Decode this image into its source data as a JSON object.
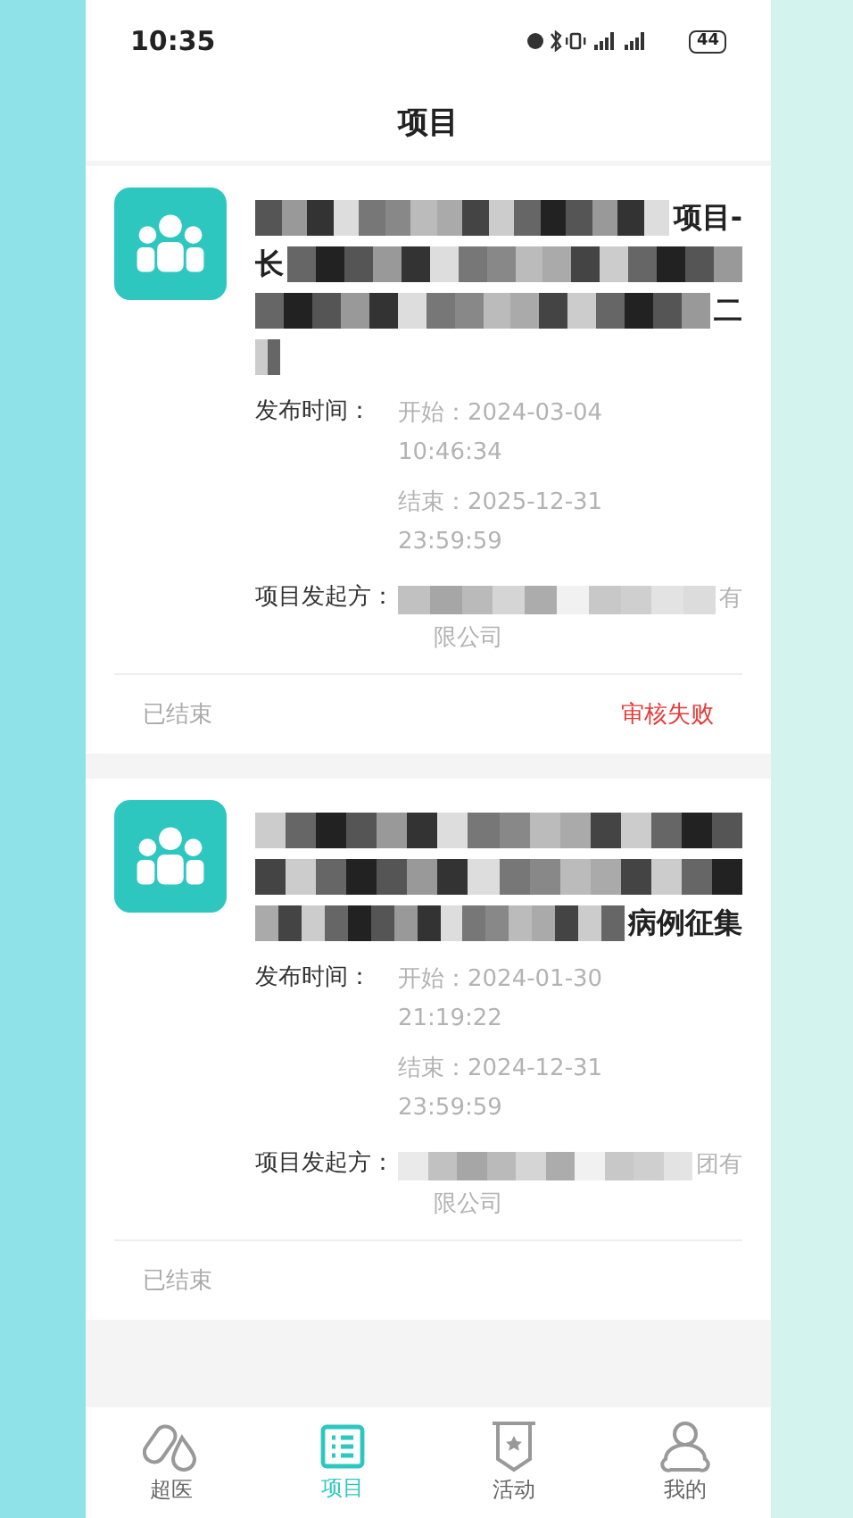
{
  "status_bar": {
    "time": "10:35",
    "battery": "44"
  },
  "header": {
    "title": "项目"
  },
  "projects": [
    {
      "title_lines": [
        [
          {
            "kind": "mosaic"
          },
          {
            "kind": "text",
            "text": "项目-"
          }
        ],
        [
          {
            "kind": "text",
            "text": "长"
          },
          {
            "kind": "mosaic"
          }
        ],
        [
          {
            "kind": "mosaic"
          },
          {
            "kind": "text",
            "text": "二"
          }
        ],
        [
          {
            "kind": "short_mosaic"
          }
        ]
      ],
      "time_label": "发布时间：",
      "start": "开始：2024-03-04",
      "start_time": "10:46:34",
      "end": "结束：2025-12-31",
      "end_time": "23:59:59",
      "organizer_label": "项目发起方：",
      "organizer_lines": [
        [
          {
            "kind": "mosaic"
          },
          {
            "kind": "text",
            "text": "有"
          }
        ],
        [
          {
            "kind": "text",
            "text": "限公司"
          }
        ]
      ],
      "status": "已结束",
      "review": "审核失败"
    },
    {
      "title_lines": [
        [
          {
            "kind": "mosaic"
          }
        ],
        [
          {
            "kind": "mosaic"
          }
        ],
        [
          {
            "kind": "mosaic"
          },
          {
            "kind": "text",
            "text": "病例征集"
          }
        ]
      ],
      "time_label": "发布时间：",
      "start": "开始：2024-01-30",
      "start_time": "21:19:22",
      "end": "结束：2024-12-31",
      "end_time": "23:59:59",
      "organizer_label": "项目发起方：",
      "organizer_lines": [
        [
          {
            "kind": "mosaic"
          },
          {
            "kind": "text",
            "text": "团有"
          }
        ],
        [
          {
            "kind": "text",
            "text": "限公司"
          }
        ]
      ],
      "status": "已结束"
    }
  ],
  "tab_bar": [
    {
      "kind": "pills",
      "label": "超医",
      "selected": false
    },
    {
      "kind": "list",
      "label": "项目",
      "selected": true
    },
    {
      "kind": "badge",
      "label": "活动",
      "selected": false
    },
    {
      "kind": "person",
      "label": "我的",
      "selected": false
    }
  ]
}
